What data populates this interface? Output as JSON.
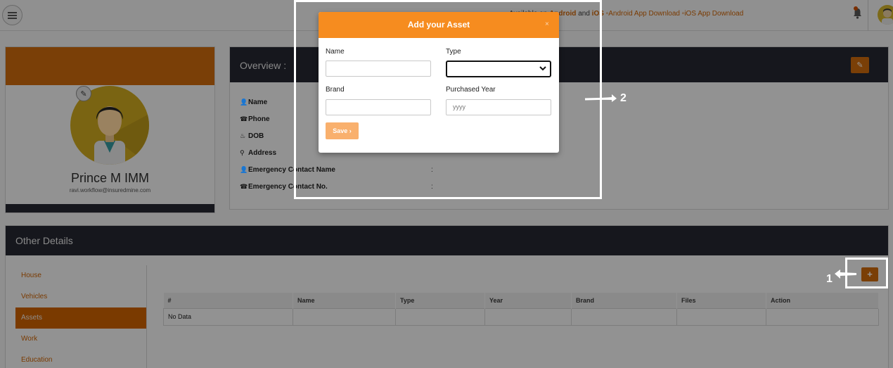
{
  "topbar": {
    "available_prefix": "Available on",
    "android": "Android",
    "and": "and",
    "ios": "iOS",
    "android_badge_alt": "Android App Download",
    "ios_badge_alt": "iOS App Download"
  },
  "profile": {
    "name": "Prince M IMM",
    "email": "ravi.workflow@insuredmine.com"
  },
  "overview": {
    "title": "Overview :",
    "fields": [
      {
        "label": "Name",
        "icon": "user-icon"
      },
      {
        "label": "Phone",
        "icon": "phone-icon"
      },
      {
        "label": "DOB",
        "icon": "cake-icon"
      },
      {
        "label": "Address",
        "icon": "map-marker-icon"
      },
      {
        "label": "Emergency Contact Name",
        "icon": "user-icon"
      },
      {
        "label": "Emergency Contact No.",
        "icon": "phone-icon"
      }
    ],
    "colon": ":"
  },
  "other_details": {
    "title": "Other Details",
    "tabs": [
      "House",
      "Vehicles",
      "Assets",
      "Work",
      "Education"
    ],
    "active_tab": "Assets",
    "add_label": "+",
    "table": {
      "columns": [
        "#",
        "Name",
        "Type",
        "Year",
        "Brand",
        "Files",
        "Action"
      ],
      "empty_text": "No Data"
    }
  },
  "modal": {
    "title": "Add your Asset",
    "close": "×",
    "name_label": "Name",
    "type_label": "Type",
    "brand_label": "Brand",
    "year_label": "Purchased Year",
    "year_placeholder": "yyyy",
    "save_label": "Save"
  },
  "annotations": {
    "one": "1",
    "two": "2"
  },
  "colors": {
    "accent": "#f68c1f",
    "dark_header": "#2b2e3b",
    "annotation": "#ffffff"
  }
}
